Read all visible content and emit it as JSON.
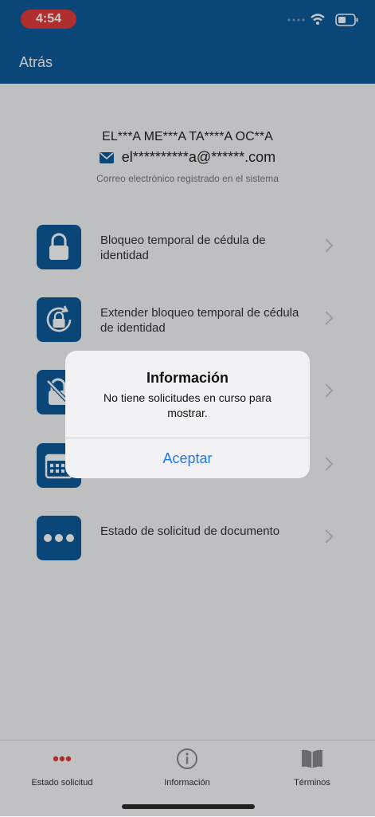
{
  "status_bar": {
    "time": "4:54"
  },
  "nav": {
    "back_label": "Atrás"
  },
  "profile": {
    "name": "EL***A ME***A TA****A OC**A",
    "email": "el**********a@******.com",
    "email_note": "Correo electrónico registrado en el sistema"
  },
  "menu": {
    "items": [
      {
        "label": "Bloqueo temporal de cédula de identidad",
        "icon": "lock-icon"
      },
      {
        "label": "Extender bloqueo temporal de cédula de identidad",
        "icon": "lock-refresh-icon"
      },
      {
        "label": "",
        "icon": "unlock-icon"
      },
      {
        "label": "",
        "icon": "calendar-icon"
      },
      {
        "label": "Estado de solicitud de documento",
        "icon": "more-icon"
      }
    ]
  },
  "alert": {
    "title": "Información",
    "message": "No tiene solicitudes en curso para mostrar.",
    "button": "Aceptar"
  },
  "tabs": [
    {
      "label": "Estado solicitud",
      "icon": "more-icon",
      "active": true
    },
    {
      "label": "Información",
      "icon": "info-icon",
      "active": false
    },
    {
      "label": "Términos",
      "icon": "book-icon",
      "active": false
    }
  ],
  "colors": {
    "primary": "#0e5a99",
    "accent": "#1f7aef",
    "active_tab": "#e23b3b"
  }
}
